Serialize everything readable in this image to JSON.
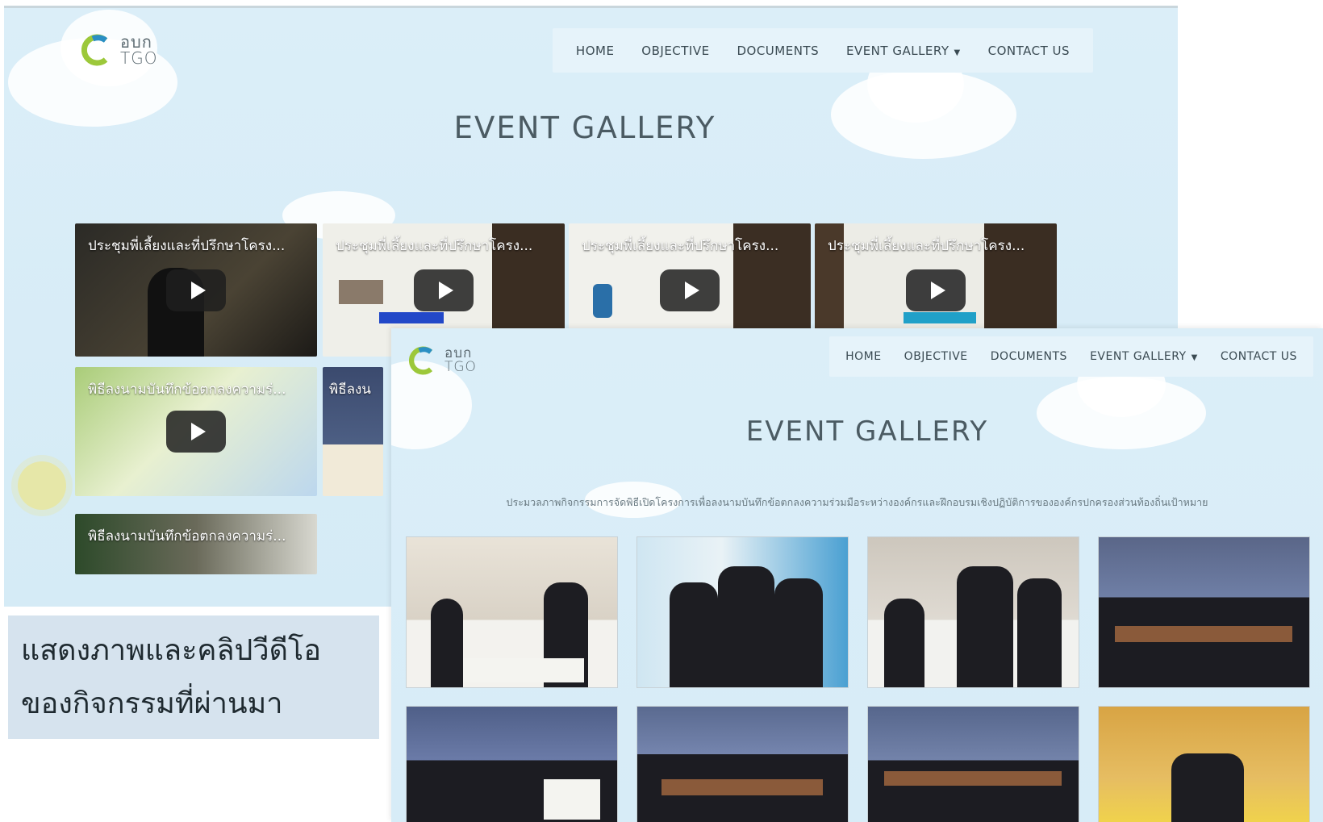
{
  "back": {
    "logo": {
      "line1": "อบก",
      "line2": "TGO"
    },
    "nav": [
      {
        "label": "HOME"
      },
      {
        "label": "OBJECTIVE"
      },
      {
        "label": "DOCUMENTS"
      },
      {
        "label": "EVENT GALLERY"
      },
      {
        "label": "CONTACT US"
      }
    ],
    "title": "EVENT GALLERY",
    "videos": [
      {
        "title": "ประชุมพี่เลี้ยงและที่ปรึกษาโครง..."
      },
      {
        "title": "ประชุมพี่เลี้ยงและที่ปรึกษาโครง..."
      },
      {
        "title": "ประชุมพี่เลี้ยงและที่ปรึกษาโครง..."
      },
      {
        "title": "ประชุมพี่เลี้ยงและที่ปรึกษาโครง..."
      },
      {
        "title": "พิธีลงนามบันทึกข้อตกลงความร่..."
      },
      {
        "title": "พิธีลงน"
      },
      {
        "title": "พิธีลงนามบันทึกข้อตกลงความร่..."
      }
    ]
  },
  "caption": {
    "line1": "แสดงภาพและคลิปวีดีโอ",
    "line2": "ของกิจกรรมที่ผ่านมา"
  },
  "front": {
    "logo": {
      "line1": "อบก",
      "line2": "TGO"
    },
    "nav": [
      {
        "label": "HOME"
      },
      {
        "label": "OBJECTIVE"
      },
      {
        "label": "DOCUMENTS"
      },
      {
        "label": "EVENT GALLERY"
      },
      {
        "label": "CONTACT US"
      }
    ],
    "title": "EVENT GALLERY",
    "description": "ประมวลภาพกิจกรรมการจัดพิธีเปิดโครงการเพื่อลงนามบันทึกข้อตกลงความร่วมมือระหว่างองค์กรและฝึกอบรมเชิงปฏิบัติการขององค์กรปกครองส่วนท้องถิ่นเป้าหมาย"
  },
  "colors": {
    "sky": "#dbeef8",
    "nav_bg": "#e6f3fa",
    "text": "#3a4a52",
    "logo_green": "#9cc83a",
    "logo_blue": "#2a8fc4",
    "caption_bg": "#d6e3ee"
  },
  "icons": {
    "video_play": "play-icon",
    "dropdown": "caret-down-icon"
  }
}
